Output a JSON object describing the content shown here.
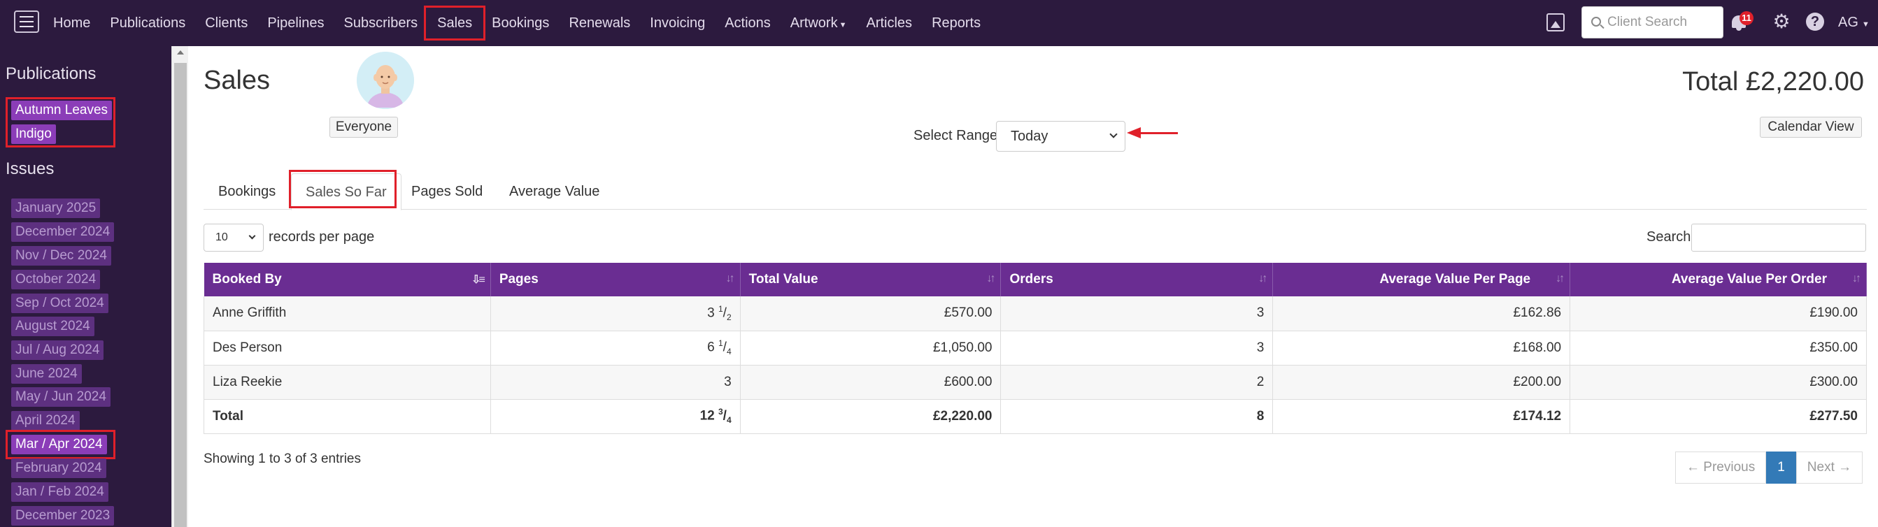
{
  "nav": {
    "items": [
      {
        "label": "Home"
      },
      {
        "label": "Publications"
      },
      {
        "label": "Clients"
      },
      {
        "label": "Pipelines"
      },
      {
        "label": "Subscribers"
      },
      {
        "label": "Sales"
      },
      {
        "label": "Bookings"
      },
      {
        "label": "Renewals"
      },
      {
        "label": "Invoicing"
      },
      {
        "label": "Actions"
      },
      {
        "label": "Artwork"
      },
      {
        "label": "Articles"
      },
      {
        "label": "Reports"
      }
    ],
    "client_search_placeholder": "Client Search",
    "notification_count": "11",
    "user_initials": "AG"
  },
  "sidebar": {
    "publications_heading": "Publications",
    "publications": [
      "Autumn Leaves",
      "Indigo"
    ],
    "issues_heading": "Issues",
    "issues": [
      "January 2025",
      "December 2024",
      "Nov / Dec 2024",
      "October 2024",
      "Sep / Oct 2024",
      "August 2024",
      "Jul / Aug 2024",
      "June 2024",
      "May / Jun 2024",
      "April 2024",
      "Mar / Apr 2024",
      "February 2024",
      "Jan / Feb 2024",
      "December 2023"
    ]
  },
  "header": {
    "title": "Sales",
    "everyone_label": "Everyone",
    "total_label": "Total £2,220.00",
    "calendar_button": "Calendar View",
    "range_label": "Select Range",
    "range_value": "Today"
  },
  "tabs": [
    "Bookings",
    "Sales So Far",
    "Pages Sold",
    "Average Value"
  ],
  "table_controls": {
    "rpp_value": "10",
    "rpp_label": "records per page",
    "search_label": "Search:"
  },
  "table": {
    "columns": [
      "Booked By",
      "Pages",
      "Total Value",
      "Orders",
      "Average Value Per Page",
      "Average Value Per Order"
    ],
    "rows": [
      {
        "booked_by": "Anne Griffith",
        "pages_whole": "3",
        "pages_num": "1",
        "pages_den": "2",
        "total": "£570.00",
        "orders": "3",
        "avg_page": "£162.86",
        "avg_order": "£190.00"
      },
      {
        "booked_by": "Des Person",
        "pages_whole": "6",
        "pages_num": "1",
        "pages_den": "4",
        "total": "£1,050.00",
        "orders": "3",
        "avg_page": "£168.00",
        "avg_order": "£350.00"
      },
      {
        "booked_by": "Liza Reekie",
        "pages_whole": "3",
        "pages_num": "",
        "pages_den": "",
        "total": "£600.00",
        "orders": "2",
        "avg_page": "£200.00",
        "avg_order": "£300.00"
      }
    ],
    "total_row": {
      "booked_by": "Total",
      "pages_whole": "12",
      "pages_num": "3",
      "pages_den": "4",
      "total": "£2,220.00",
      "orders": "8",
      "avg_page": "£174.12",
      "avg_order": "£277.50"
    }
  },
  "footer": {
    "showing": "Showing 1 to 3 of 3 entries",
    "prev": "← Previous",
    "page": "1",
    "next": "Next →"
  },
  "colors": {
    "nav_bg": "#2c1a3e",
    "table_header": "#6a2d92",
    "highlight": "#e0202a",
    "pager_active": "#337ab7"
  }
}
